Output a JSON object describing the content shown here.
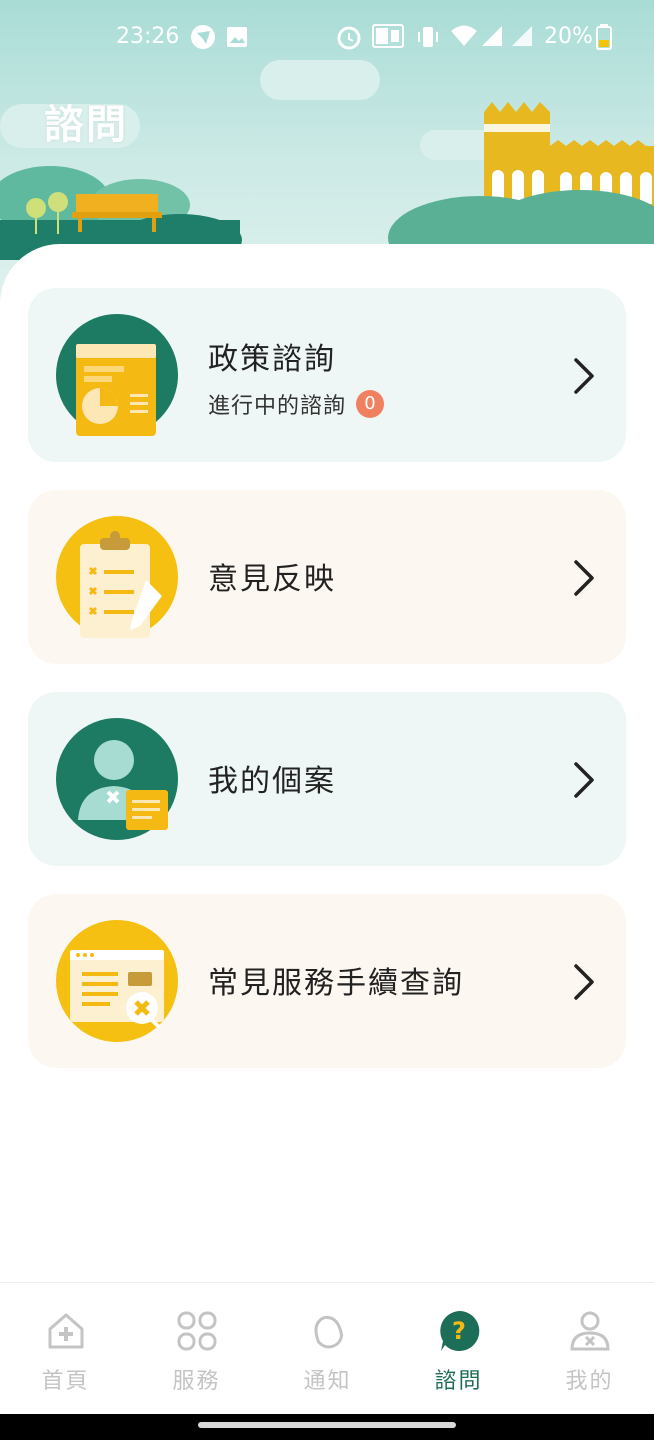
{
  "status_bar": {
    "time": "23:26",
    "battery": "20%",
    "icons": [
      "send-icon",
      "image-icon",
      "alarm-icon",
      "volte-icon",
      "vibrate-icon",
      "wifi-icon",
      "signal-icon",
      "signal-icon",
      "battery-icon"
    ]
  },
  "header": {
    "title": "諮問"
  },
  "cards": [
    {
      "title": "政策諮詢",
      "subtitle": "進行中的諮詢",
      "count": "0",
      "icon": "policy-chart-icon",
      "chevron": "chevron-right-icon"
    },
    {
      "title": "意見反映",
      "icon": "clipboard-icon",
      "chevron": "chevron-right-icon"
    },
    {
      "title": "我的個案",
      "icon": "user-case-icon",
      "chevron": "chevron-right-icon"
    },
    {
      "title": "常見服務手續查詢",
      "icon": "service-search-icon",
      "chevron": "chevron-right-icon"
    }
  ],
  "nav": [
    {
      "label": "首頁",
      "icon": "home-icon"
    },
    {
      "label": "服務",
      "icon": "services-icon"
    },
    {
      "label": "通知",
      "icon": "bell-icon"
    },
    {
      "label": "諮問",
      "icon": "question-icon",
      "active": true
    },
    {
      "label": "我的",
      "icon": "profile-icon"
    }
  ],
  "colors": {
    "primary_green": "#1d6e58",
    "accent_yellow": "#f5b914",
    "badge": "#f08060",
    "card_green_bg": "#eef7f5",
    "card_cream_bg": "#fdf7f1"
  }
}
